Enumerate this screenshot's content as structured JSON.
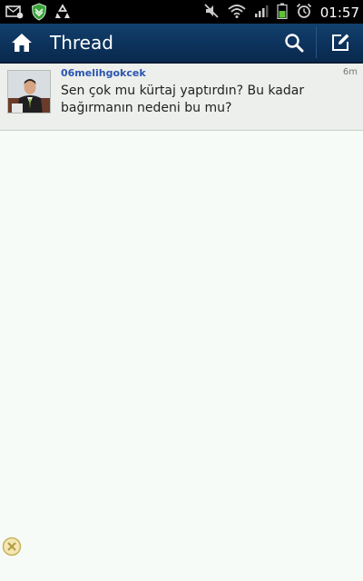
{
  "status_bar": {
    "time": "01:57",
    "icons": [
      "mail-icon",
      "shield-icon",
      "recycle-icon",
      "mute-icon",
      "wifi-icon",
      "signal-icon",
      "battery-icon",
      "alarm-icon"
    ]
  },
  "action_bar": {
    "title": "Thread",
    "icons": [
      "home-icon",
      "search-icon",
      "compose-icon"
    ]
  },
  "thread": {
    "messages": [
      {
        "username": "06melihgokcek",
        "time": "6m",
        "text": "Sen çok mu kürtaj yaptırdın? Bu kadar bağırmanın nedeni bu mu?"
      }
    ]
  },
  "colors": {
    "action_bar": "#0b2f57",
    "username": "#2b55b0",
    "background": "#f7fbf7"
  }
}
